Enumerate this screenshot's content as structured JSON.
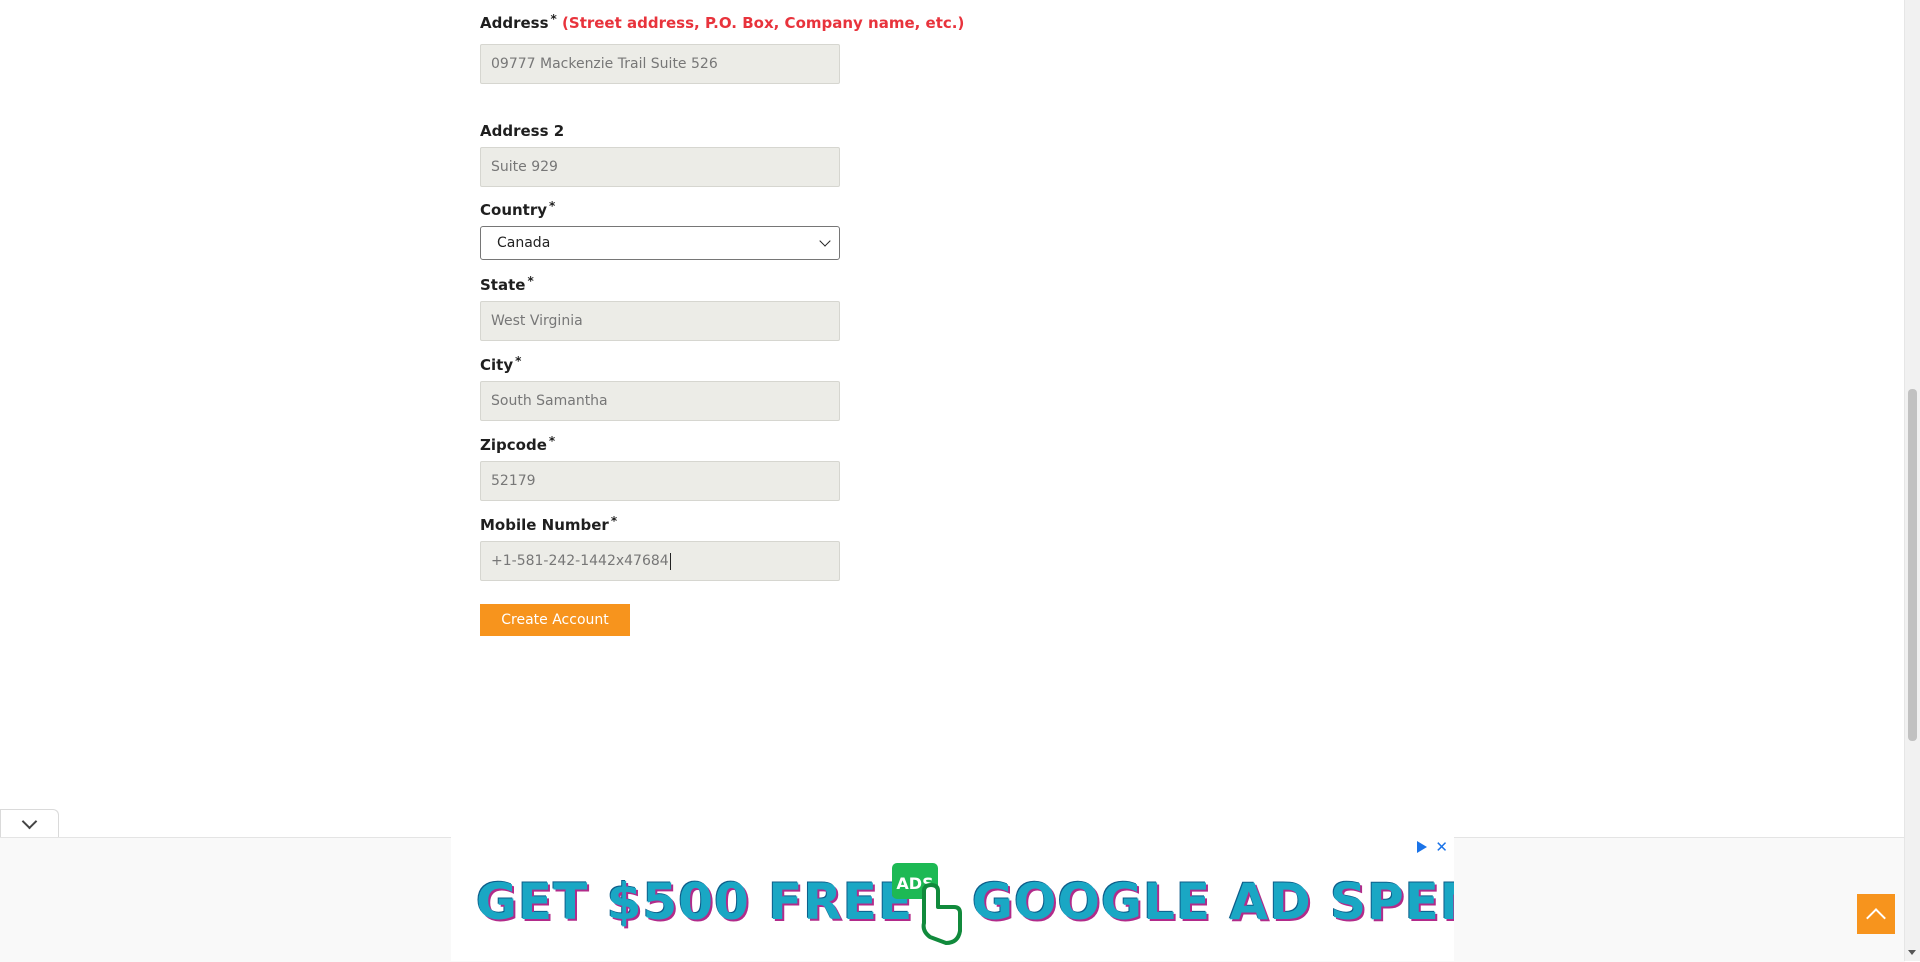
{
  "form": {
    "address": {
      "label": "Address",
      "required": "*",
      "hint": "(Street address, P.O. Box, Company name, etc.)",
      "value": "09777 Mackenzie Trail Suite 526"
    },
    "address2": {
      "label": "Address 2",
      "value": "Suite 929"
    },
    "country": {
      "label": "Country",
      "required": "*",
      "value": "Canada"
    },
    "state": {
      "label": "State",
      "required": "*",
      "value": "West Virginia"
    },
    "city": {
      "label": "City",
      "required": "*",
      "value": "South Samantha"
    },
    "zipcode": {
      "label": "Zipcode",
      "required": "*",
      "value": "52179"
    },
    "mobile": {
      "label": "Mobile Number",
      "required": "*",
      "value": "+1-581-242-1442x47684"
    },
    "submit_label": "Create Account"
  },
  "ad": {
    "left_text": "GET $500 FREE",
    "logo_text": "ADS",
    "right_text": "GOOGLE AD SPEND",
    "icons": [
      "adchoices-play-icon",
      "close-icon"
    ]
  },
  "colors": {
    "accent": "#f7941d",
    "hint_red": "#e8333c",
    "input_bg": "#ecece7"
  }
}
